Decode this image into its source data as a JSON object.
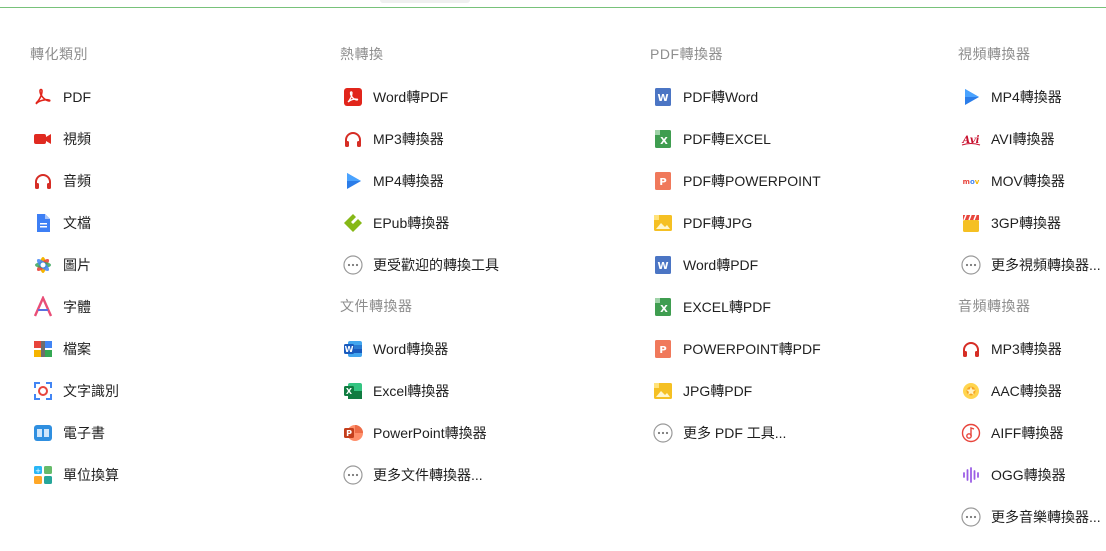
{
  "columns": [
    {
      "heading": "轉化類別",
      "items": [
        {
          "label": "PDF",
          "icon": "pdf-icon"
        },
        {
          "label": "視頻",
          "icon": "video-icon"
        },
        {
          "label": "音頻",
          "icon": "headphones-icon"
        },
        {
          "label": "文檔",
          "icon": "document-icon"
        },
        {
          "label": "圖片",
          "icon": "image-icon"
        },
        {
          "label": "字體",
          "icon": "font-icon"
        },
        {
          "label": "檔案",
          "icon": "archive-icon"
        },
        {
          "label": "文字識別",
          "icon": "ocr-icon"
        },
        {
          "label": "電子書",
          "icon": "ebook-icon"
        },
        {
          "label": "單位換算",
          "icon": "calculator-icon"
        }
      ]
    },
    {
      "heading": "熱轉換",
      "items": [
        {
          "label": "Word轉PDF",
          "icon": "acrobat-icon"
        },
        {
          "label": "MP3轉換器",
          "icon": "headphones-icon"
        },
        {
          "label": "MP4轉換器",
          "icon": "play-icon"
        },
        {
          "label": "EPub轉換器",
          "icon": "epub-icon"
        },
        {
          "label": "更受歡迎的轉換工具",
          "icon": "more-icon"
        }
      ],
      "heading2": "文件轉換器",
      "items2": [
        {
          "label": "Word轉換器",
          "icon": "word-icon"
        },
        {
          "label": "Excel轉換器",
          "icon": "excel-icon"
        },
        {
          "label": "PowerPoint轉換器",
          "icon": "powerpoint-icon"
        },
        {
          "label": "更多文件轉換器...",
          "icon": "more-icon"
        }
      ]
    },
    {
      "heading": "PDF轉換器",
      "items": [
        {
          "label": "PDF轉Word",
          "icon": "word-doc-icon"
        },
        {
          "label": "PDF轉EXCEL",
          "icon": "excel-doc-icon"
        },
        {
          "label": "PDF轉POWERPOINT",
          "icon": "ppt-doc-icon"
        },
        {
          "label": "PDF轉JPG",
          "icon": "jpg-doc-icon"
        },
        {
          "label": "Word轉PDF",
          "icon": "word-doc-icon"
        },
        {
          "label": "EXCEL轉PDF",
          "icon": "excel-doc-icon"
        },
        {
          "label": "POWERPOINT轉PDF",
          "icon": "ppt-doc-icon"
        },
        {
          "label": "JPG轉PDF",
          "icon": "jpg-doc-icon"
        },
        {
          "label": "更多 PDF 工具...",
          "icon": "more-icon"
        }
      ]
    },
    {
      "heading": "視頻轉換器",
      "items": [
        {
          "label": "MP4轉換器",
          "icon": "play-icon"
        },
        {
          "label": "AVI轉換器",
          "icon": "avi-icon"
        },
        {
          "label": "MOV轉換器",
          "icon": "mov-icon"
        },
        {
          "label": "3GP轉換器",
          "icon": "clapper-icon"
        },
        {
          "label": "更多視頻轉換器...",
          "icon": "more-icon"
        }
      ],
      "heading2": "音頻轉換器",
      "items2": [
        {
          "label": "MP3轉換器",
          "icon": "headphones-icon"
        },
        {
          "label": "AAC轉換器",
          "icon": "aac-icon"
        },
        {
          "label": "AIFF轉換器",
          "icon": "music-note-icon"
        },
        {
          "label": "OGG轉換器",
          "icon": "waveform-icon"
        },
        {
          "label": "更多音樂轉換器...",
          "icon": "more-icon"
        }
      ]
    }
  ]
}
